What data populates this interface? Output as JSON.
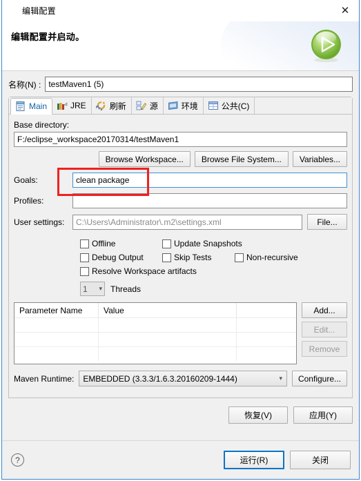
{
  "window": {
    "title": "编辑配置",
    "title_icon": "gear-icon",
    "close_label": "✕"
  },
  "header": {
    "title": "编辑配置并启动。",
    "badge_icon": "run-play-icon"
  },
  "name_field": {
    "label": "名称(N) :",
    "value": "testMaven1 (5)"
  },
  "tabs": [
    {
      "label": "Main",
      "icon": "document-icon",
      "active": true
    },
    {
      "label": "JRE",
      "icon": "jre-books-icon",
      "active": false
    },
    {
      "label": "刷新",
      "icon": "refresh-icon",
      "active": false
    },
    {
      "label": "源",
      "icon": "source-pencil-icon",
      "active": false
    },
    {
      "label": "环境",
      "icon": "environment-icon",
      "active": false
    },
    {
      "label": "公共(C)",
      "icon": "common-table-icon",
      "active": false
    }
  ],
  "main_tab": {
    "base_directory": {
      "label": "Base directory:",
      "value": "F:/eclipse_workspace20170314/testMaven1"
    },
    "browse_buttons": [
      {
        "label": "Browse Workspace..."
      },
      {
        "label": "Browse File System..."
      },
      {
        "label": "Variables..."
      }
    ],
    "goals": {
      "label": "Goals:",
      "value": "clean package",
      "focused": true
    },
    "profiles": {
      "label": "Profiles:",
      "value": ""
    },
    "user_settings": {
      "label": "User settings:",
      "value": "C:\\Users\\Administrator\\.m2\\settings.xml",
      "button_label": "File..."
    },
    "checkboxes": [
      {
        "label": "Offline",
        "checked": false
      },
      {
        "label": "Update Snapshots",
        "checked": false
      },
      {
        "label": "Debug Output",
        "checked": false
      },
      {
        "label": "Skip Tests",
        "checked": false
      },
      {
        "label": "Non-recursive",
        "checked": false
      },
      {
        "label": "Resolve Workspace artifacts",
        "checked": false
      }
    ],
    "threads": {
      "value": "1",
      "label": "Threads"
    },
    "parameter_table": {
      "columns": [
        "Parameter Name",
        "Value"
      ],
      "rows": [],
      "buttons": [
        {
          "label": "Add...",
          "enabled": true
        },
        {
          "label": "Edit...",
          "enabled": false
        },
        {
          "label": "Remove",
          "enabled": false
        }
      ]
    },
    "maven_runtime": {
      "label": "Maven Runtime:",
      "value": "EMBEDDED (3.3.3/1.6.3.20160209-1444)",
      "button_label": "Configure..."
    }
  },
  "apply_buttons": {
    "revert": "恢复(V)",
    "apply": "应用(Y)"
  },
  "footer": {
    "help_icon": "help-question-icon",
    "run_label": "运行(R)",
    "close_label": "关闭"
  },
  "colors": {
    "accent_blue": "#0a74c8",
    "annotation_red": "#f02020",
    "run_green": "#7bbf3f",
    "dialog_bg": "#f0f0f0"
  }
}
